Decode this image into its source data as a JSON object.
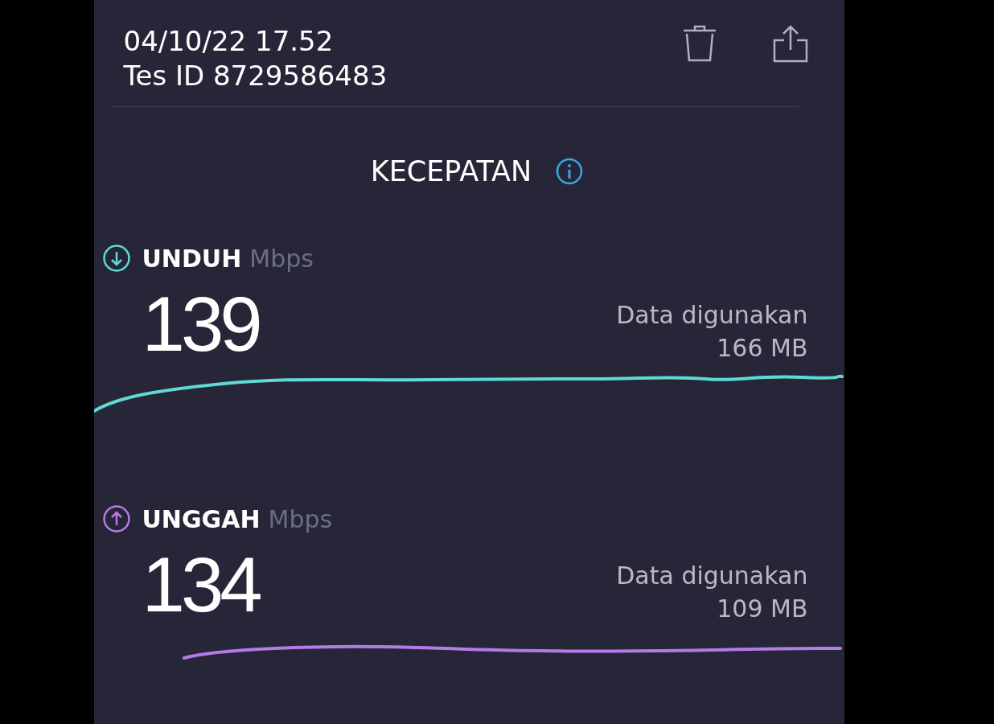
{
  "header": {
    "date": "04/10/22 17.52",
    "test_id": "Tes ID 8729586483"
  },
  "section_title": "KECEPATAN",
  "metrics": [
    {
      "kind": "download",
      "label": "UNDUH",
      "unit": "Mbps",
      "value": "139",
      "data_label": "Data digunakan",
      "data_value": "166 MB",
      "color": "#5fd9d6"
    },
    {
      "kind": "upload",
      "label": "UNGGAH",
      "unit": "Mbps",
      "value": "134",
      "data_label": "Data digunakan",
      "data_value": "109 MB",
      "color": "#b47be6"
    }
  ]
}
